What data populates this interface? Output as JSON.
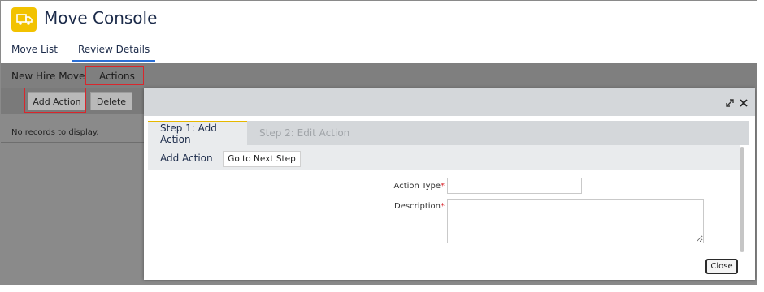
{
  "app": {
    "title": "Move Console",
    "icon": "truck-icon",
    "accent_color": "#f2c200"
  },
  "tabs": [
    {
      "label": "Move List"
    },
    {
      "label": "Review Details",
      "active": true
    }
  ],
  "subtabs": [
    {
      "label": "New Hire Move"
    },
    {
      "label": "Actions",
      "highlighted": true
    }
  ],
  "toolbar": {
    "add_label": "Add Action",
    "delete_label": "Delete"
  },
  "list": {
    "empty_text": "No records to display."
  },
  "modal": {
    "steps": [
      {
        "label": "Step 1: Add Action",
        "active": true
      },
      {
        "label": "Step 2: Edit Action",
        "active": false
      }
    ],
    "section_title": "Add Action",
    "next_button": "Go to Next Step",
    "fields": {
      "action_type_label": "Action Type",
      "action_type_value": "",
      "description_label": "Description",
      "description_value": "",
      "required_mark": "*"
    },
    "close_label": "Close",
    "icons": [
      "expand-icon",
      "close-icon"
    ]
  },
  "colors": {
    "highlight_border": "#d9262c",
    "active_tab_underline": "#2a6fd6",
    "step_active_bar": "#e5b700"
  }
}
